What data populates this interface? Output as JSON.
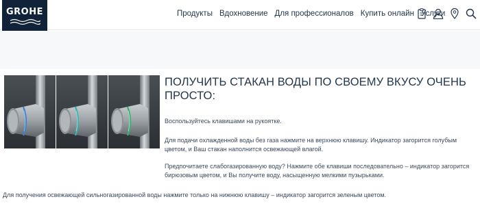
{
  "header": {
    "logo_text": "GROHE",
    "nav": [
      "Продукты",
      "Вдохновение",
      "Для профессионалов",
      "Купить онлайн",
      "Услуги"
    ],
    "icons": [
      "clipboard-icon",
      "user-icon",
      "location-pin-icon",
      "search-icon"
    ]
  },
  "colors": {
    "logo_bg": "#112338",
    "band_bg": "#f7f8f9",
    "text": "#22354a",
    "indicator_blue": "#3b7fd6",
    "indicator_turquoise": "#2fb5b0",
    "indicator_green": "#2fb56a"
  },
  "images": [
    {
      "indicator": "blue"
    },
    {
      "indicator": "turquoise"
    },
    {
      "indicator": "green"
    }
  ],
  "main": {
    "heading": "ПОЛУЧИТЬ СТАКАН ВОДЫ ПО СВОЕМУ ВКУСУ ОЧЕНЬ ПРОСТО:",
    "paragraphs": [
      "Воспользуйтесь клавишами на рукоятке.",
      "Для подачи охлажденной воды без газа нажмите на верхнюю клавишу. Индикатор загорится голубым цветом, и Ваш стакан наполнится освежающей влагой.",
      "Предпочитаете слабогазированную воду? Нажмите обе клавиши последовательно – индикатор загорится бирюзовым цветом, и Вы получите воду, насыщенную мелкими пузырьками.",
      "Для получения освежающей сильногазированной воды нажмите только на нижнюю клавишу – индикатор загорится зеленым цветом."
    ]
  }
}
